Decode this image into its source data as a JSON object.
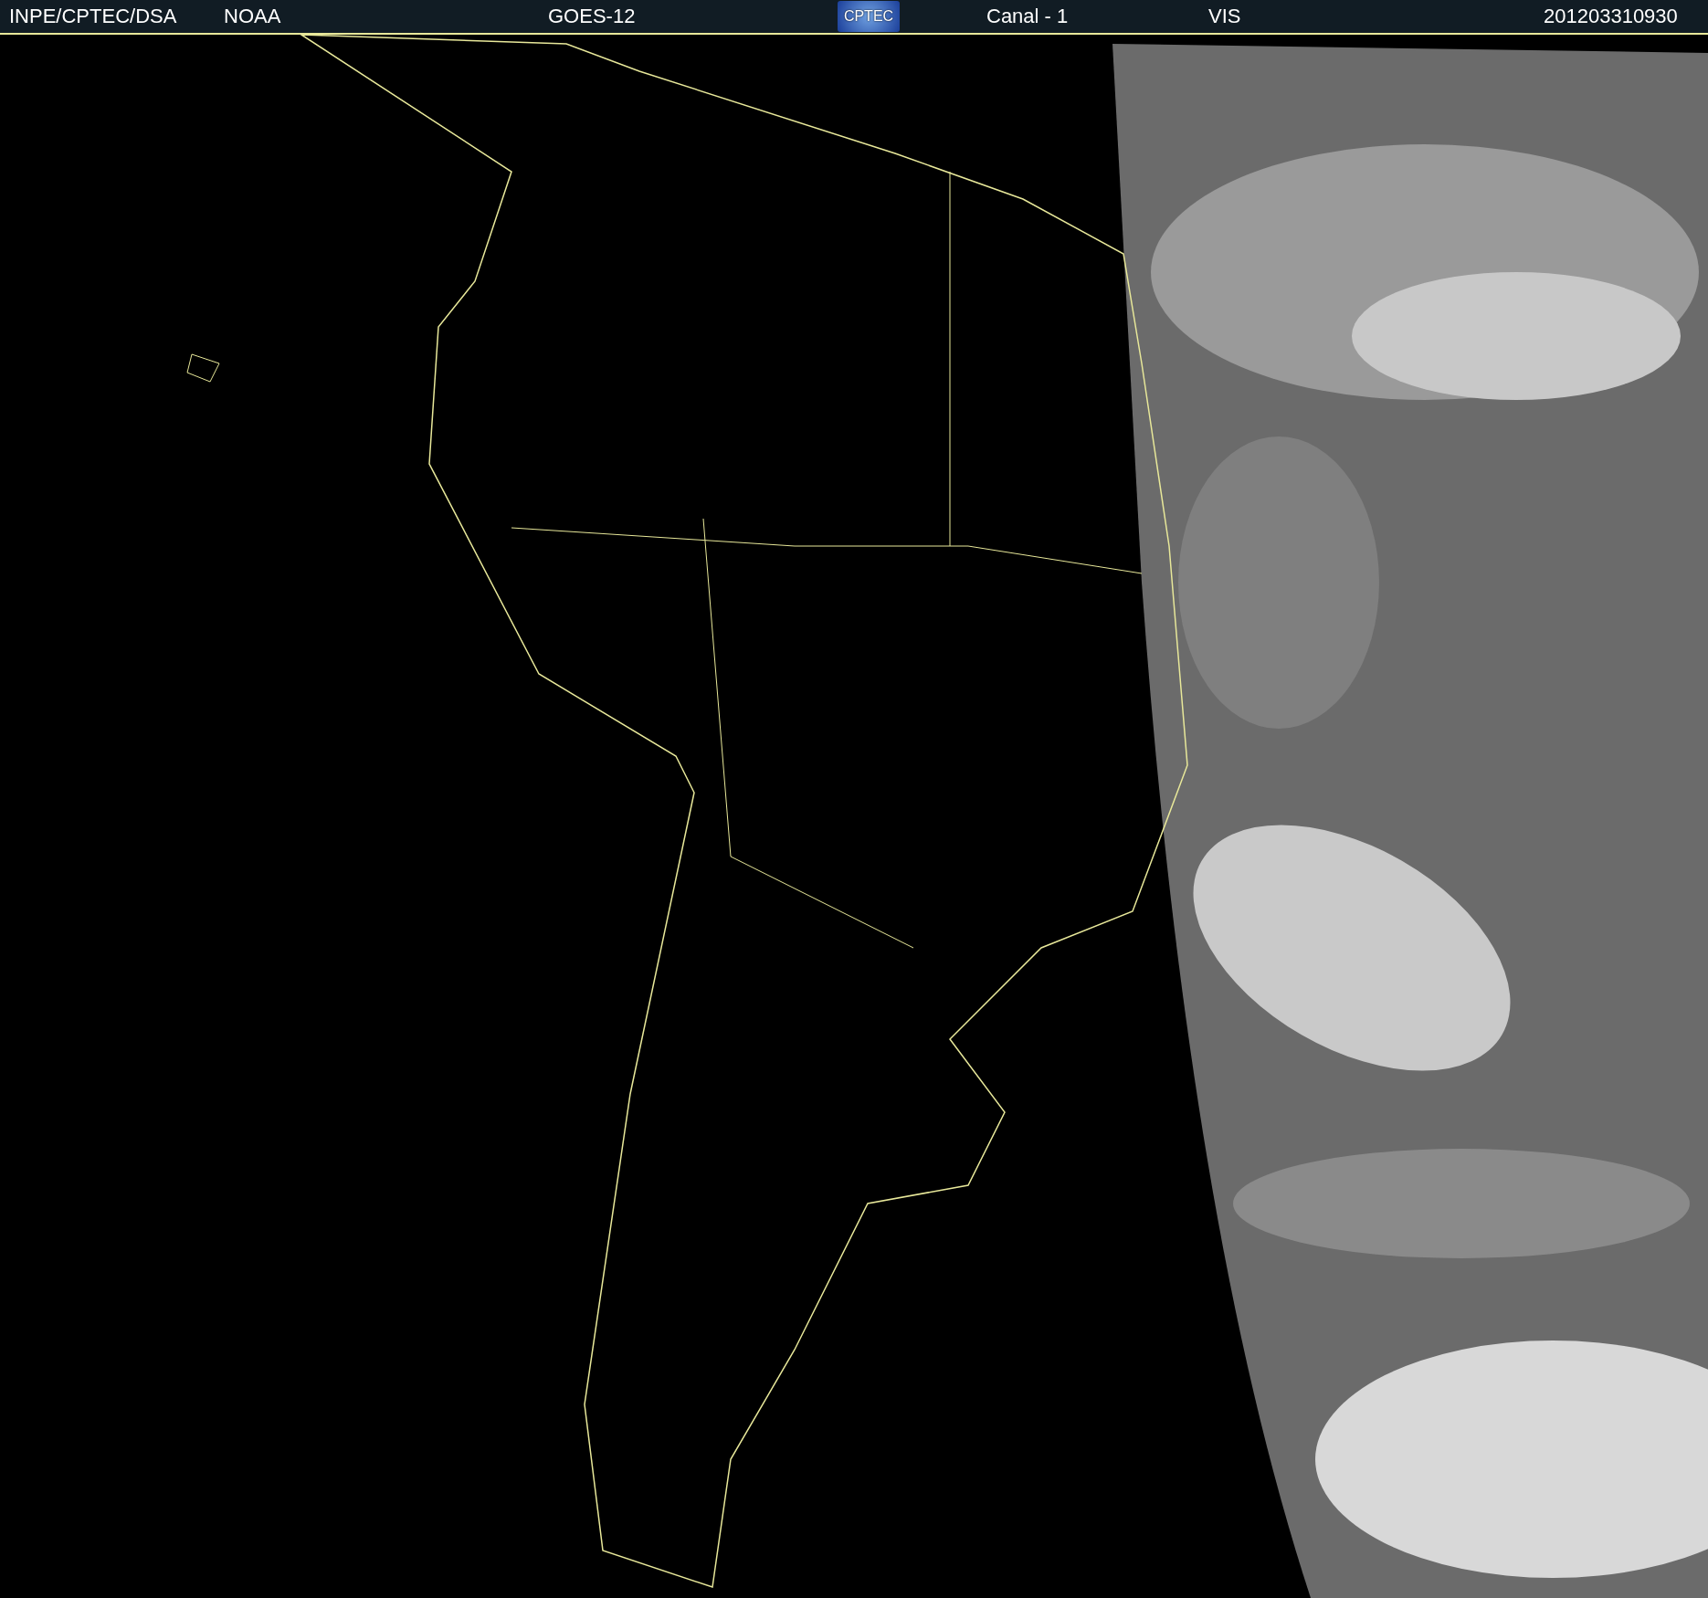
{
  "header": {
    "source": "INPE/CPTEC/DSA",
    "agency": "NOAA",
    "satellite": "GOES-12",
    "logo": {
      "text": "CPTEC"
    },
    "channel": "Canal - 1",
    "band": "VIS",
    "timestamp": "201203310930"
  }
}
